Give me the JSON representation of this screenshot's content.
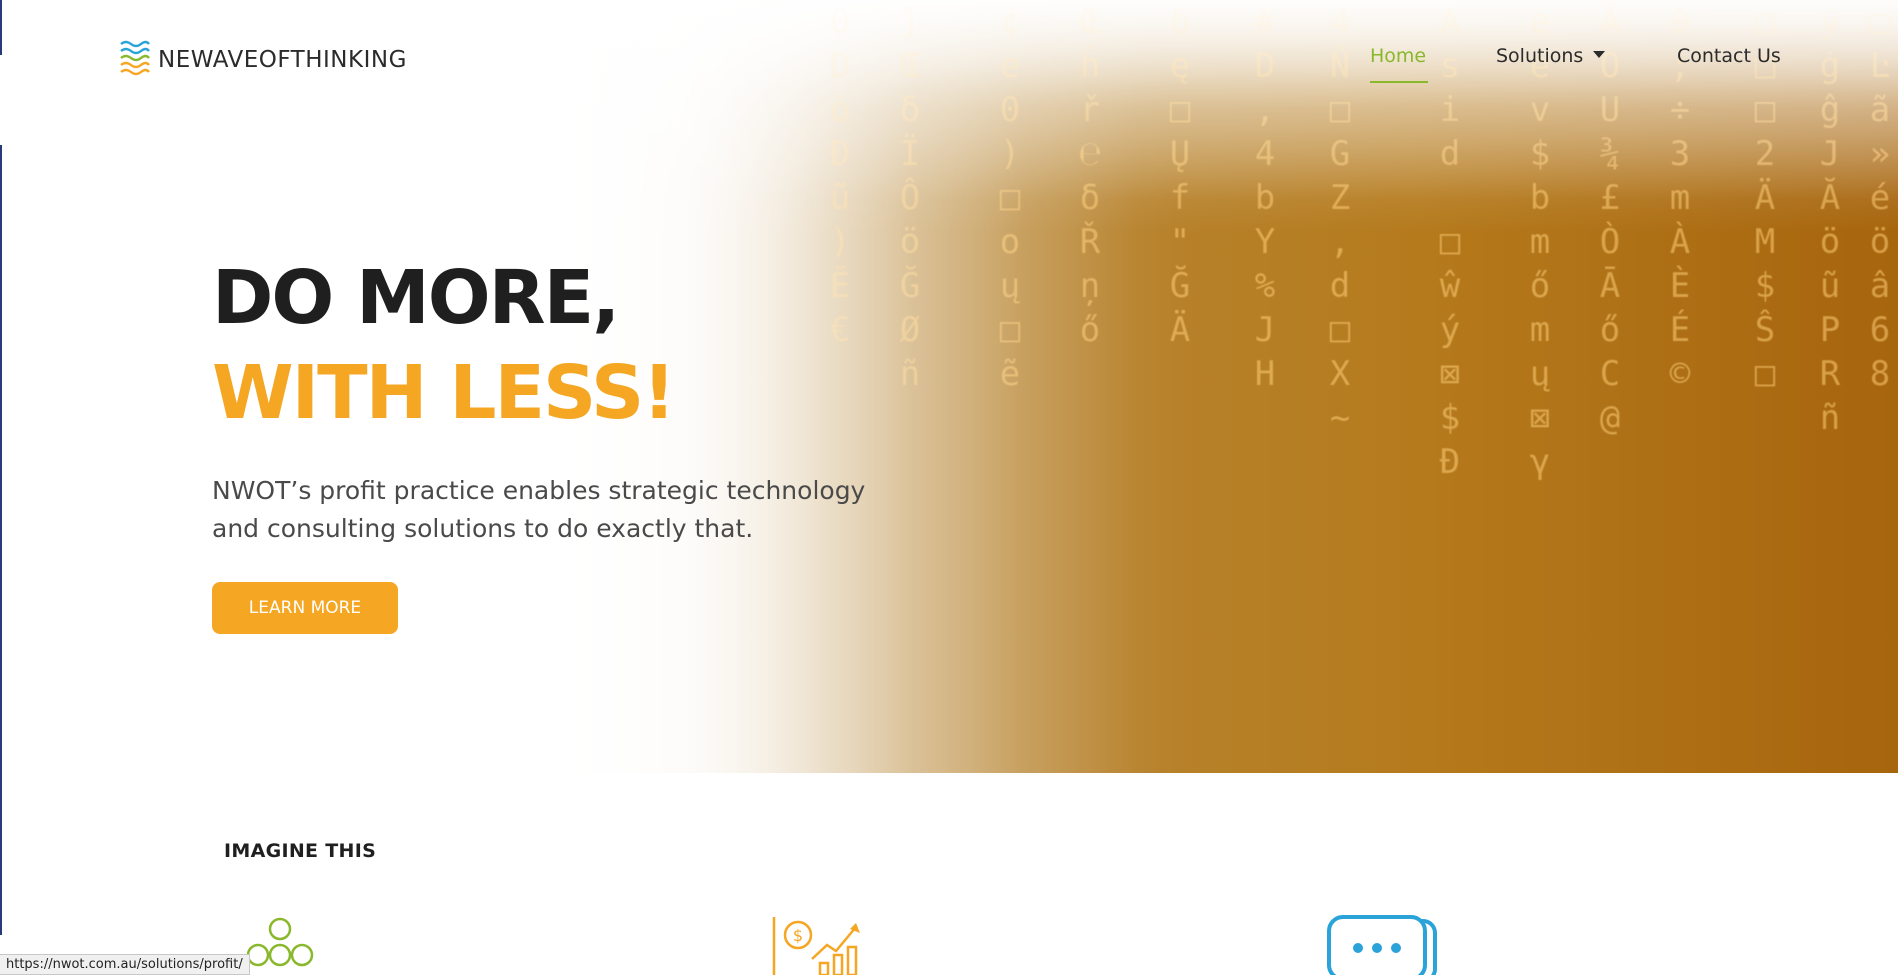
{
  "header": {
    "logo_text": "NEWAVEOFTHINKING",
    "nav": {
      "home": "Home",
      "solutions": "Solutions",
      "contact": "Contact Us"
    }
  },
  "hero": {
    "headline_line1": "DO MORE,",
    "headline_line2": "WITH LESS!",
    "subtext": "NWOT’s profit practice enables strategic technology and consulting solutions to do exactly that.",
    "cta_label": "LEARN MORE"
  },
  "imagine": {
    "heading": "IMAGINE THIS",
    "icons": [
      "people-group-icon",
      "dollar-growth-chart-icon",
      "chat-bubble-icon"
    ]
  },
  "status_bar": {
    "url": "https://nwot.com.au/solutions/profit/"
  },
  "colors": {
    "accent_orange": "#f5a623",
    "accent_green": "#8ab82d",
    "accent_blue": "#2aa3d9"
  }
}
